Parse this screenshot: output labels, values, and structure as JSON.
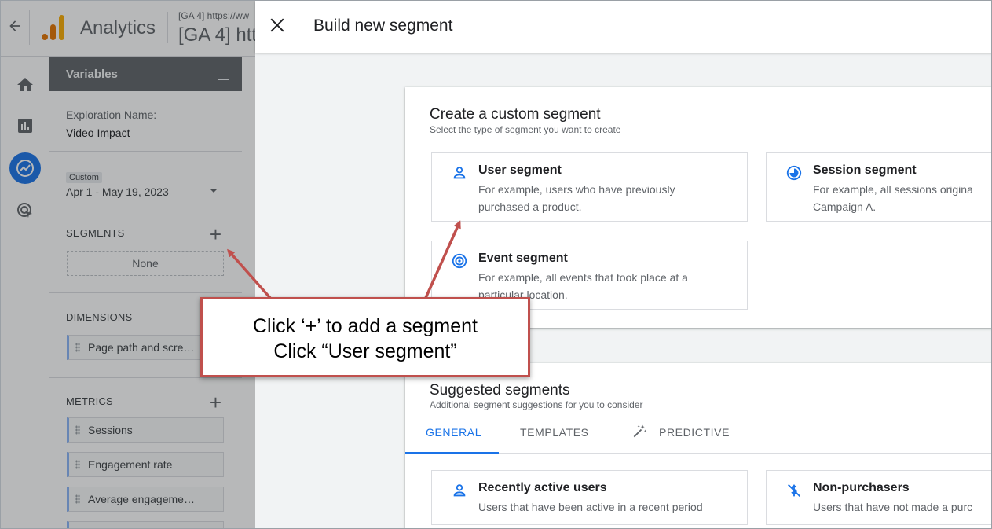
{
  "app_header": {
    "app_name": "Analytics",
    "property_small": "[GA 4] https://ww",
    "property_large": "[GA 4] htt"
  },
  "rail": {
    "icons": [
      "home-icon",
      "reports-icon",
      "explore-icon",
      "advertising-icon"
    ]
  },
  "variables_panel": {
    "title": "Variables",
    "exploration_label": "Exploration Name:",
    "exploration_value": "Video Impact",
    "date_chip": "Custom",
    "date_range": "Apr 1 - May 19, 2023",
    "segments_label": "SEGMENTS",
    "segments_empty": "None",
    "dimensions_label": "DIMENSIONS",
    "dimensions": [
      "Page path and scre…"
    ],
    "metrics_label": "METRICS",
    "metrics": [
      "Sessions",
      "Engagement rate",
      "Average engageme…"
    ]
  },
  "modal": {
    "title": "Build new segment",
    "custom": {
      "title": "Create a custom segment",
      "subtitle": "Select the type of segment you want to create",
      "options": [
        {
          "title": "User segment",
          "line1": "For example, users who have previously",
          "line2": "purchased a product.",
          "icon": "user-icon"
        },
        {
          "title": "Session segment",
          "line1": "For example, all sessions origina",
          "line2": "Campaign A.",
          "icon": "session-icon"
        },
        {
          "title": "Event segment",
          "line1": "For example, all events that took place at a",
          "line2": "particular location.",
          "icon": "event-icon"
        }
      ]
    },
    "suggested": {
      "title": "Suggested segments",
      "subtitle": "Additional segment suggestions for you to consider",
      "tabs": [
        "GENERAL",
        "TEMPLATES",
        "PREDICTIVE"
      ],
      "active_tab": "GENERAL",
      "items": [
        {
          "title": "Recently active users",
          "line1": "Users that have been active in a recent period",
          "icon": "user-icon"
        },
        {
          "title": "Non-purchasers",
          "line1": "Users that have not made a purc",
          "icon": "no-purchase-icon"
        }
      ]
    }
  },
  "annotation": {
    "line1": "Click ‘+’ to add a segment",
    "line2": "Click “User segment”"
  },
  "colors": {
    "accent": "#1a73e8",
    "annotation_border": "#c0504d"
  }
}
